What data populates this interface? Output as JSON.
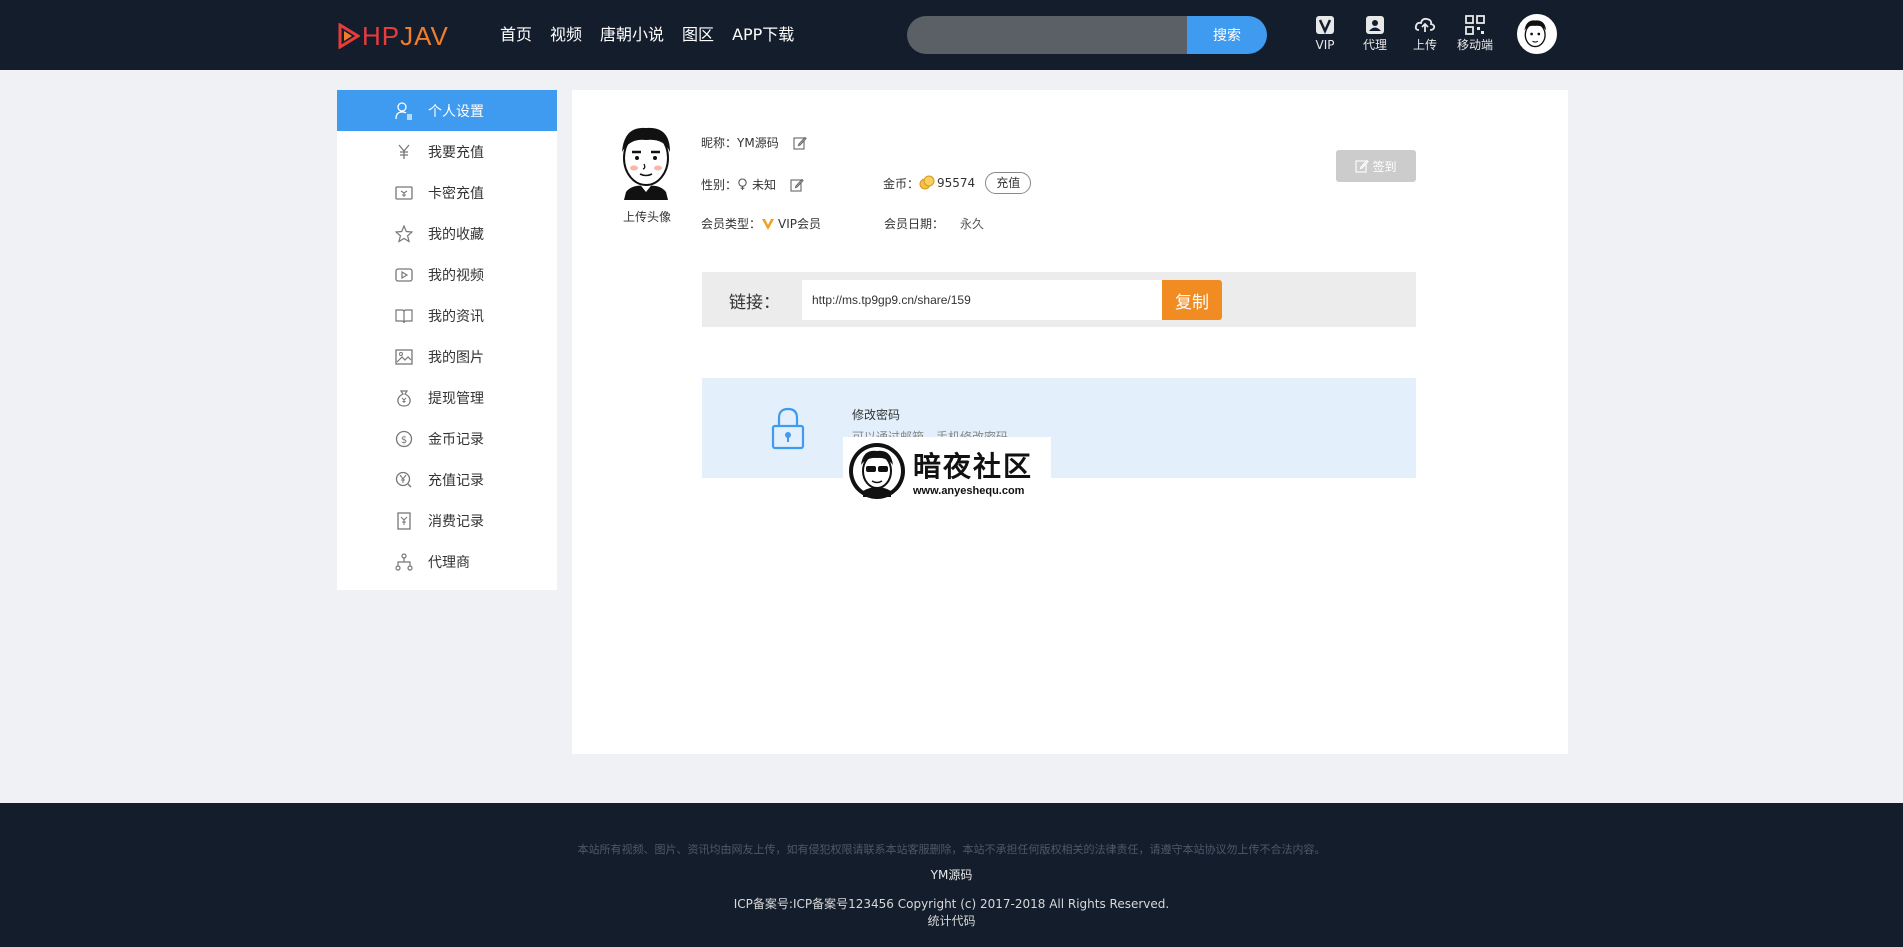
{
  "header": {
    "logo_part1": "HP",
    "logo_part2": "JAV",
    "nav": [
      "首页",
      "视频",
      "唐朝小说",
      "图区",
      "APP下载"
    ],
    "search": {
      "placeholder": "",
      "button": "搜索"
    },
    "tools": [
      {
        "icon": "vip-icon",
        "label": "VIP"
      },
      {
        "icon": "agent-icon",
        "label": "代理"
      },
      {
        "icon": "upload-cloud-icon",
        "label": "上传"
      },
      {
        "icon": "qrcode-icon",
        "label": "移动端"
      }
    ]
  },
  "sidebar": {
    "items": [
      {
        "label": "个人设置",
        "icon": "user-settings-icon",
        "active": true
      },
      {
        "label": "我要充值",
        "icon": "yen-recharge-icon"
      },
      {
        "label": "卡密充值",
        "icon": "card-ticket-icon"
      },
      {
        "label": "我的收藏",
        "icon": "star-icon"
      },
      {
        "label": "我的视频",
        "icon": "video-play-icon"
      },
      {
        "label": "我的资讯",
        "icon": "book-icon"
      },
      {
        "label": "我的图片",
        "icon": "image-icon"
      },
      {
        "label": "提现管理",
        "icon": "money-bag-icon"
      },
      {
        "label": "金币记录",
        "icon": "dollar-coin-icon"
      },
      {
        "label": "充值记录",
        "icon": "yen-coin-icon"
      },
      {
        "label": "消费记录",
        "icon": "receipt-icon"
      },
      {
        "label": "代理商",
        "icon": "org-tree-icon"
      }
    ]
  },
  "profile": {
    "upload_avatar": "上传头像",
    "nickname_label": "昵称：",
    "nickname": "YM源码",
    "gender_label": "性别：",
    "gender": "未知",
    "coins_label": "金币：",
    "coins": "95574",
    "recharge": "充值",
    "member_type_label": "会员类型：",
    "member_type": "VIP会员",
    "member_date_label": "会员日期：",
    "member_date": "永久",
    "sign_in": "签到"
  },
  "share": {
    "label": "链接：",
    "url": "http://ms.tp9gp9.cn/share/159",
    "copy": "复制"
  },
  "password": {
    "title": "修改密码",
    "desc": "可以通过邮箱、手机修改密码"
  },
  "watermark": {
    "title": "暗夜社区",
    "url": "www.anyeshequ.com"
  },
  "footer": {
    "note": "本站所有视频、图片、资讯均由网友上传，如有侵犯权限请联系本站客服删除，本站不承担任何版权相关的法律责任，请遵守本站协议勿上传不合法内容。",
    "brand": "YM源码",
    "copyright": "ICP备案号:ICP备案号123456    Copyright (c) 2017-2018 All Rights Reserved.",
    "stats": "统计代码"
  },
  "colors": {
    "header_bg": "#141d2c",
    "accent_blue": "#3f9bf0",
    "copy_orange": "#f08c22",
    "logo_red": "#e83b3b",
    "logo_orange": "#f07d2a"
  }
}
